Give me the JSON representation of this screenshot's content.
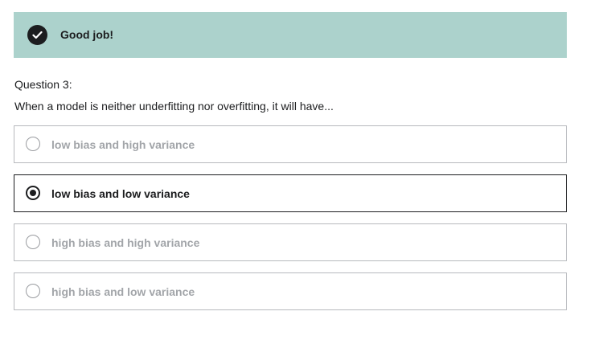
{
  "feedback": {
    "icon": "checkmark-icon",
    "message": "Good job!",
    "color": "#acd2cc"
  },
  "question": {
    "label": "Question 3:",
    "text": "When a model is neither underfitting nor overfitting, it will have..."
  },
  "options": [
    {
      "label": "low bias and high variance",
      "selected": false
    },
    {
      "label": "low bias and low variance",
      "selected": true
    },
    {
      "label": "high bias and high variance",
      "selected": false
    },
    {
      "label": "high bias and low variance",
      "selected": false
    }
  ]
}
